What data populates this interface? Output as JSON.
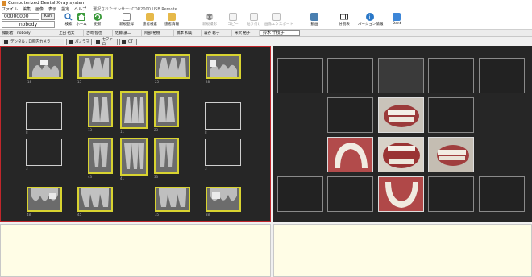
{
  "window": {
    "title": "Computerized Dental X-ray system"
  },
  "menu": {
    "items": [
      "ファイル",
      "編集",
      "画像",
      "表示",
      "設定",
      "ヘルプ"
    ],
    "sensor": "選択されたセンサー: CDR2000 USB Remote"
  },
  "patient": {
    "id_value": "00000000",
    "kana_label": "Kan",
    "name_value": "nobody"
  },
  "toolbar": {
    "buttons": [
      {
        "label": "検索",
        "icon": "search-icon"
      },
      {
        "label": "ホーム",
        "icon": "home-icon"
      },
      {
        "label": "更新",
        "icon": "refresh-icon"
      },
      {
        "label": "新規登録",
        "icon": "new-document-icon"
      },
      {
        "label": "患者検索",
        "icon": "folder-search-icon"
      },
      {
        "label": "患者情報",
        "icon": "folder-info-icon"
      },
      {
        "label": "新規撮影",
        "icon": "radiation-icon"
      },
      {
        "label": "コピー",
        "icon": "copy-icon"
      },
      {
        "label": "貼り付け",
        "icon": "paste-icon"
      },
      {
        "label": "画像エクスポート",
        "icon": "export-icon"
      },
      {
        "label": "動画",
        "icon": "video-icon"
      },
      {
        "label": "分割表",
        "icon": "grid-icon"
      },
      {
        "label": "バージョン情報",
        "icon": "info-icon"
      },
      {
        "label": "Dent",
        "icon": "dent-app-icon"
      }
    ],
    "disabled": [
      false,
      false,
      false,
      false,
      false,
      false,
      true,
      true,
      true,
      true,
      false,
      false,
      false,
      false
    ]
  },
  "staff_bar": {
    "cells": [
      "撮影者 : nobody",
      "上田 祐太",
      "吉崎 智也",
      "佐藤 謙二",
      "阿部 裕樹",
      "橋本 和美",
      "森谷 聡子",
      "米沢 裕子",
      "鈴木 千枝子"
    ]
  },
  "tabs": [
    "デンタル / 口腔内カメラ",
    "パノラマ",
    "セファロ",
    "CT"
  ],
  "xray_labels": {
    "top_row": [
      "18",
      "15",
      "25",
      "28"
    ],
    "upper_front": [
      "13",
      "11",
      "23"
    ],
    "mid_labels_left": [
      "8",
      "3"
    ],
    "mid_labels_right": [
      "8",
      "3"
    ],
    "lower_front": [
      "43",
      "41",
      "33"
    ],
    "bottom_row": [
      "48",
      "45",
      "35",
      "38"
    ]
  },
  "colors": {
    "panel_bg": "#262626",
    "xray_frame": "#d8d330",
    "active_border": "#c0262b",
    "note_bg": "#fffde6"
  }
}
